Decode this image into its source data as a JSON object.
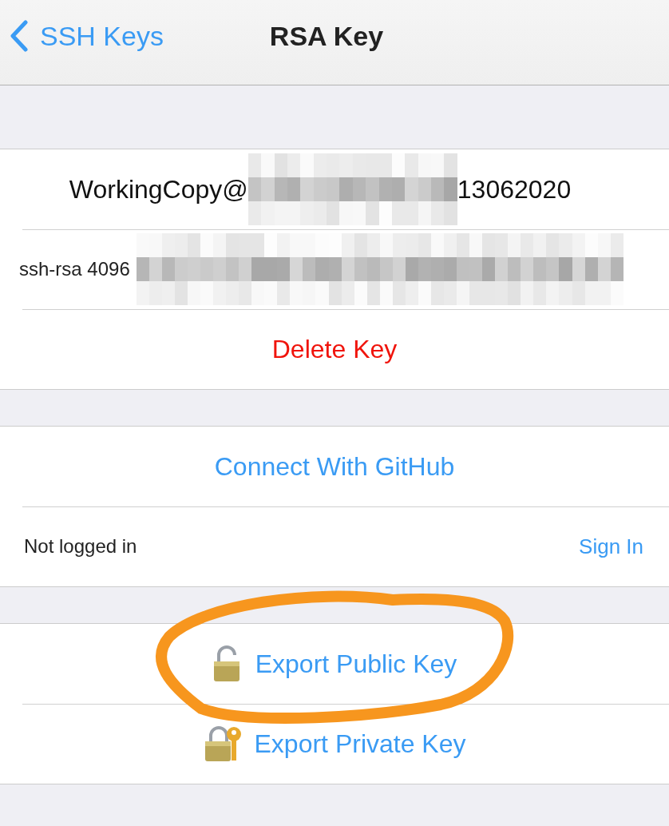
{
  "nav": {
    "back_label": "SSH Keys",
    "title": "RSA Key"
  },
  "sections": [
    {
      "rows": [
        {
          "kind": "redacted-centered",
          "prefix": "WorkingCopy@",
          "suffix": "13062020"
        },
        {
          "kind": "redacted-left",
          "prefix": "ssh-rsa 4096"
        },
        {
          "kind": "destructive-action",
          "label": "Delete Key"
        }
      ]
    },
    {
      "rows": [
        {
          "kind": "link-action",
          "label": "Connect With GitHub"
        },
        {
          "kind": "detail",
          "label": "Not logged in",
          "action": "Sign In"
        }
      ]
    },
    {
      "rows": [
        {
          "kind": "export-public",
          "label": "Export Public Key",
          "circled": true
        },
        {
          "kind": "export-private",
          "label": "Export Private Key",
          "circled": false
        }
      ]
    }
  ]
}
